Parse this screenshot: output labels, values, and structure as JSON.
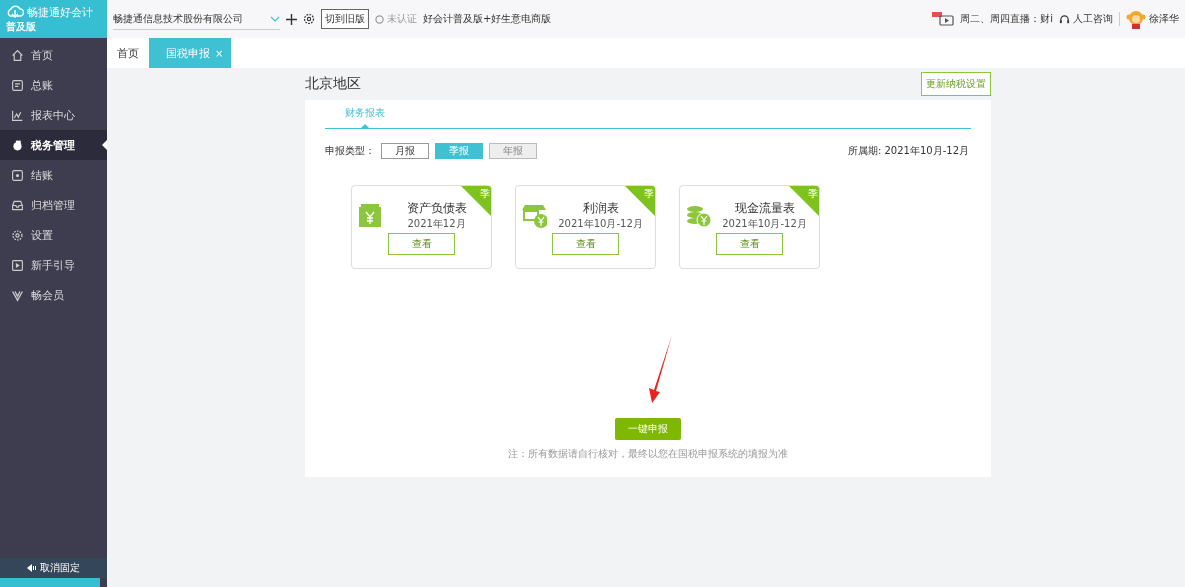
{
  "app": {
    "logo_text": "畅捷通好会计",
    "edition": "普及版"
  },
  "sidebar": {
    "items": [
      {
        "label": "首页",
        "selected": false
      },
      {
        "label": "总账",
        "selected": false
      },
      {
        "label": "报表中心",
        "selected": false
      },
      {
        "label": "税务管理",
        "selected": true
      },
      {
        "label": "结账",
        "selected": false
      },
      {
        "label": "归档管理",
        "selected": false
      },
      {
        "label": "设置",
        "selected": false
      },
      {
        "label": "新手引导",
        "selected": false
      },
      {
        "label": "畅会员",
        "selected": false
      }
    ],
    "unpin": "取消固定"
  },
  "topbar": {
    "company": "畅捷通信息技术股份有限公司",
    "switch_button": "切到旧版",
    "certification": "未认证",
    "products": "好会计普及版+好生意电商版",
    "live": "周二、周四直播：财i",
    "consult": "人工咨询",
    "user": "徐泽华"
  },
  "tabs": [
    {
      "label": "首页",
      "selected": false,
      "closable": false
    },
    {
      "label": "国税申报",
      "selected": true,
      "closable": true,
      "close": "×"
    }
  ],
  "page": {
    "region": "北京地区",
    "settings_button": "更新纳税设置",
    "subtabs": [
      {
        "label": "财务报表",
        "selected": true
      }
    ],
    "type_label": "申报类型：",
    "period_types": [
      {
        "label": "月报",
        "selected": false,
        "disabled": false
      },
      {
        "label": "季报",
        "selected": true,
        "disabled": false
      },
      {
        "label": "年报",
        "selected": false,
        "disabled": true
      }
    ],
    "period": "所属期: 2021年10月-12月",
    "reports": [
      {
        "kind": "balance",
        "title": "资产负债表",
        "period": "2021年12月",
        "button": "查看",
        "badge": "季"
      },
      {
        "kind": "income",
        "title": "利润表",
        "period": "2021年10月-12月",
        "button": "查看",
        "badge": "季"
      },
      {
        "kind": "cash",
        "title": "现金流量表",
        "period": "2021年10月-12月",
        "button": "查看",
        "badge": "季"
      }
    ],
    "submit": "一键申报",
    "note": "注：所有数据请自行核对，最终以您在国税申报系统的填报为准"
  }
}
